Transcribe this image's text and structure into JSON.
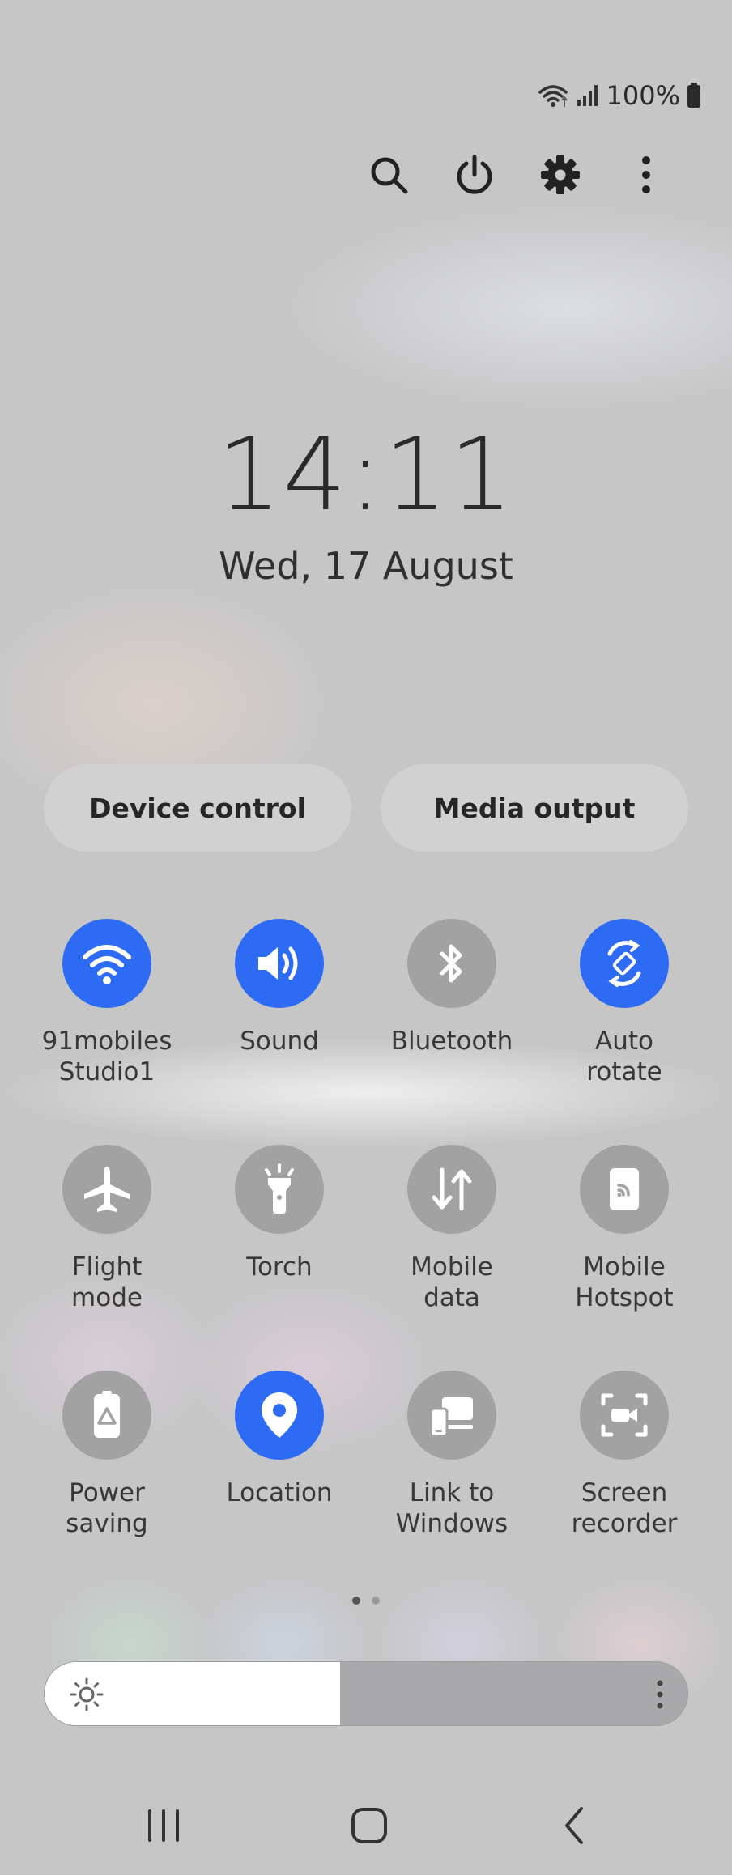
{
  "status_bar": {
    "battery_text": "100%"
  },
  "top_actions": [
    {
      "name": "search-button",
      "icon": "search-icon"
    },
    {
      "name": "power-button",
      "icon": "power-icon"
    },
    {
      "name": "settings-button",
      "icon": "gear-icon"
    },
    {
      "name": "more-options-button",
      "icon": "more-vertical-icon"
    }
  ],
  "clock": {
    "time": "14:11",
    "date": "Wed, 17 August"
  },
  "pills": {
    "device_control": "Device control",
    "media_output": "Media output"
  },
  "tiles": [
    {
      "label": "91mobiles\nStudio1",
      "icon": "wifi-icon",
      "on": true
    },
    {
      "label": "Sound",
      "icon": "speaker-icon",
      "on": true
    },
    {
      "label": "Bluetooth",
      "icon": "bluetooth-icon",
      "on": false
    },
    {
      "label": "Auto\nrotate",
      "icon": "auto-rotate-icon",
      "on": true
    },
    {
      "label": "Flight\nmode",
      "icon": "airplane-icon",
      "on": false
    },
    {
      "label": "Torch",
      "icon": "flashlight-icon",
      "on": false
    },
    {
      "label": "Mobile\ndata",
      "icon": "mobile-data-icon",
      "on": false
    },
    {
      "label": "Mobile\nHotspot",
      "icon": "hotspot-icon",
      "on": false
    },
    {
      "label": "Power\nsaving",
      "icon": "power-saving-icon",
      "on": false
    },
    {
      "label": "Location",
      "icon": "location-pin-icon",
      "on": true
    },
    {
      "label": "Link to\nWindows",
      "icon": "link-to-windows-icon",
      "on": false
    },
    {
      "label": "Screen\nrecorder",
      "icon": "screen-recorder-icon",
      "on": false
    }
  ],
  "pages": {
    "count": 2,
    "current": 1
  },
  "brightness": {
    "level": 0.46
  },
  "colors": {
    "accent": "#2e6bf5",
    "tile_off": "#a2a2a3"
  }
}
